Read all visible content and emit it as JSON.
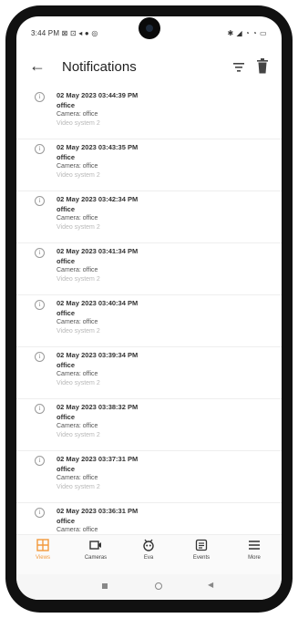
{
  "status_bar": {
    "time": "3:44 PM",
    "left_icons": "⊠ ⊡ ◂ ● ◎",
    "right_icons": "✱ ◢ ◔ ◔ ▭"
  },
  "app_bar": {
    "title": "Notifications"
  },
  "notifications": [
    {
      "datetime": "02 May 2023 03:44:39 PM",
      "name": "office",
      "camera": "Camera: office",
      "system": "Video system 2"
    },
    {
      "datetime": "02 May 2023 03:43:35 PM",
      "name": "office",
      "camera": "Camera: office",
      "system": "Video system 2"
    },
    {
      "datetime": "02 May 2023 03:42:34 PM",
      "name": "office",
      "camera": "Camera: office",
      "system": "Video system 2"
    },
    {
      "datetime": "02 May 2023 03:41:34 PM",
      "name": "office",
      "camera": "Camera: office",
      "system": "Video system 2"
    },
    {
      "datetime": "02 May 2023 03:40:34 PM",
      "name": "office",
      "camera": "Camera: office",
      "system": "Video system 2"
    },
    {
      "datetime": "02 May 2023 03:39:34 PM",
      "name": "office",
      "camera": "Camera: office",
      "system": "Video system 2"
    },
    {
      "datetime": "02 May 2023 03:38:32 PM",
      "name": "office",
      "camera": "Camera: office",
      "system": "Video system 2"
    },
    {
      "datetime": "02 May 2023 03:37:31 PM",
      "name": "office",
      "camera": "Camera: office",
      "system": "Video system 2"
    },
    {
      "datetime": "02 May 2023 03:36:31 PM",
      "name": "office",
      "camera": "Camera: office",
      "system": ""
    }
  ],
  "bottom_nav": {
    "views": "Views",
    "cameras": "Cameras",
    "eva": "Eva",
    "events": "Events",
    "more": "More",
    "active_color": "#f39a3c"
  }
}
